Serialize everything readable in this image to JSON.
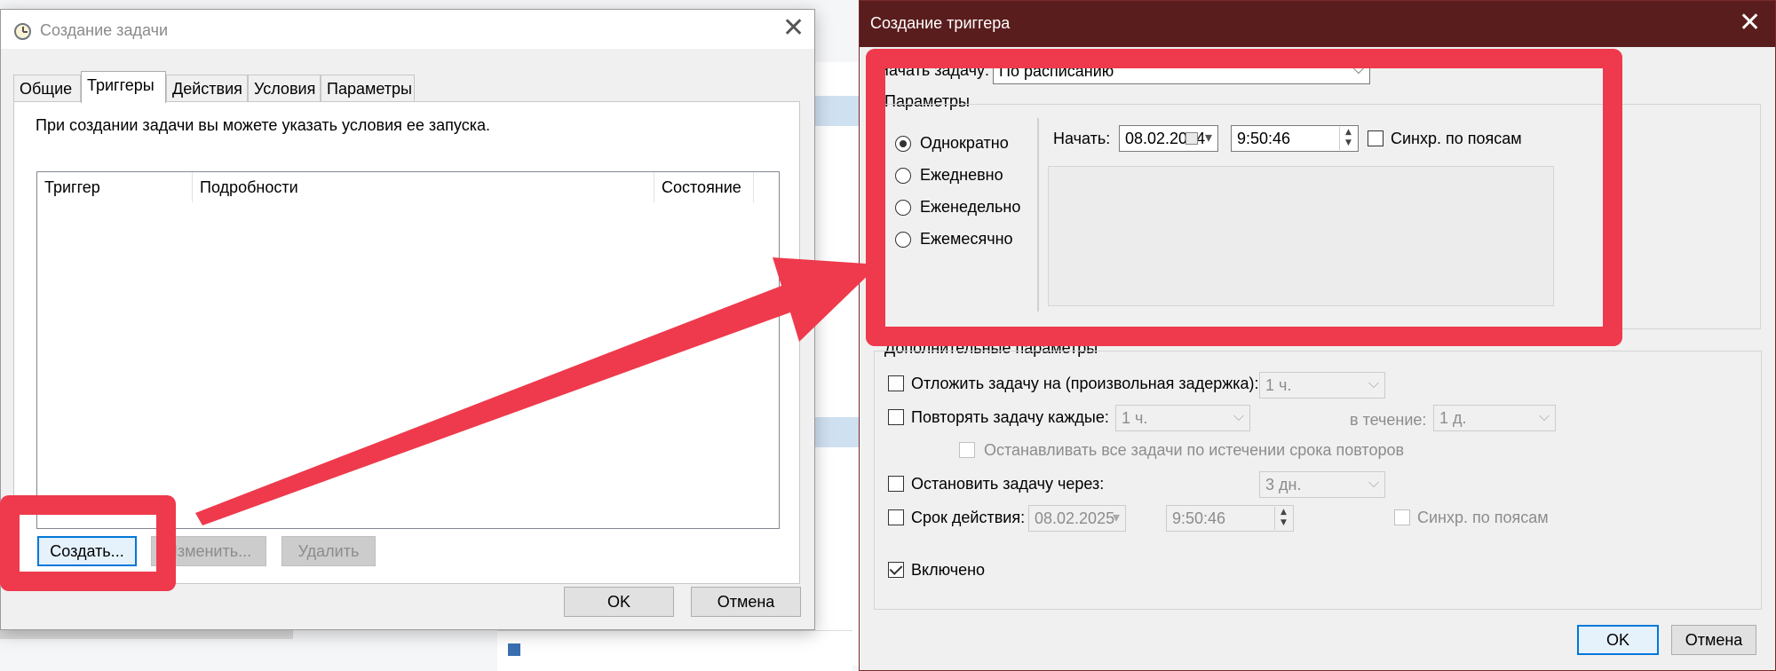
{
  "dialog_create_task": {
    "title": "Создание задачи",
    "tabs": [
      "Общие",
      "Триггеры",
      "Действия",
      "Условия",
      "Параметры"
    ],
    "active_tab": "Триггеры",
    "hint": "При создании задачи вы можете указать условия ее запуска.",
    "columns": [
      "Триггер",
      "Подробности",
      "Состояние"
    ],
    "buttons": {
      "create": "Создать...",
      "edit": "Изменить...",
      "delete": "Удалить"
    },
    "ok": "OK",
    "cancel": "Отмена"
  },
  "dialog_create_trigger": {
    "title": "Создание триггера",
    "start_task_label": "Начать задачу:",
    "start_task_value": "По расписанию",
    "params_label": "Параметры",
    "schedule_options": [
      "Однократно",
      "Ежедневно",
      "Еженедельно",
      "Ежемесячно"
    ],
    "selected_schedule": "Однократно",
    "start_label": "Начать:",
    "start_date": "08.02.2024",
    "start_time": "9:50:46",
    "sync_tz_label": "Синхр. по поясам",
    "advanced_label": "Дополнительные параметры",
    "delay_label": "Отложить задачу на (произвольная задержка):",
    "delay_value": "1 ч.",
    "repeat_label": "Повторять задачу каждые:",
    "repeat_value": "1 ч.",
    "duration_label": "в течение:",
    "duration_value": "1 д.",
    "stop_all_label": "Останавливать все задачи по истечении срока повторов",
    "stop_after_label": "Остановить задачу через:",
    "stop_after_value": "3 дн.",
    "expire_label": "Срок действия:",
    "expire_date": "08.02.2025",
    "expire_time": "9:50:46",
    "expire_sync_label": "Синхр. по поясам",
    "enabled_label": "Включено",
    "enabled": true,
    "ok": "OK",
    "cancel": "Отмена"
  },
  "annotation_color": "#ee3a4c"
}
